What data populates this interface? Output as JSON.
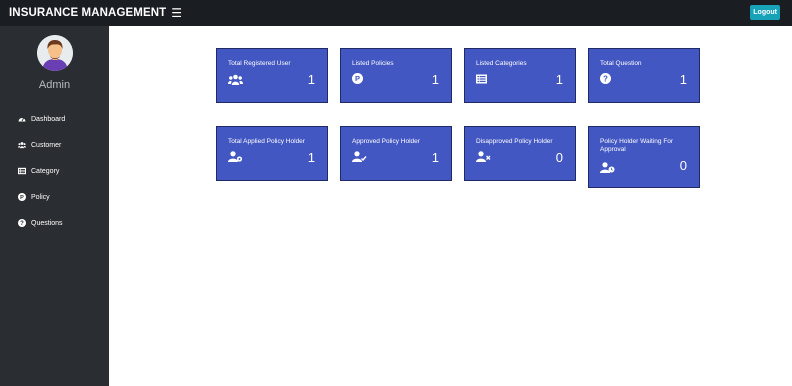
{
  "header": {
    "brand": "INSURANCE MANAGEMENT",
    "menu_icon": "hamburger-icon",
    "logout_label": "Logout",
    "background": "#1a1d21"
  },
  "sidebar": {
    "admin_name": "Admin",
    "avatar_icon": "user-avatar",
    "items": [
      {
        "label": "Dashboard",
        "icon": "dashboard-icon"
      },
      {
        "label": "Customer",
        "icon": "users-icon"
      },
      {
        "label": "Category",
        "icon": "list-icon"
      },
      {
        "label": "Policy",
        "icon": "policy-icon"
      },
      {
        "label": "Questions",
        "icon": "question-icon"
      }
    ]
  },
  "cards": [
    {
      "title": "Total Registered User",
      "value": "1",
      "icon": "users-icon"
    },
    {
      "title": "Listed Policies",
      "value": "1",
      "icon": "policy-icon"
    },
    {
      "title": "Listed Categories",
      "value": "1",
      "icon": "list-icon"
    },
    {
      "title": "Total Question",
      "value": "1",
      "icon": "question-icon"
    },
    {
      "title": "Total Applied Policy Holder",
      "value": "1",
      "icon": "user-cog-icon"
    },
    {
      "title": "Approved Policy Holder",
      "value": "1",
      "icon": "user-check-icon"
    },
    {
      "title": "Disapproved Policy Holder",
      "value": "0",
      "icon": "user-times-icon"
    },
    {
      "title": "Policy Holder Waiting For Approval",
      "value": "0",
      "icon": "user-clock-icon"
    }
  ],
  "colors": {
    "card": "#4357c2",
    "sidebar": "#2a2d31",
    "logout": "#17a2b8"
  }
}
